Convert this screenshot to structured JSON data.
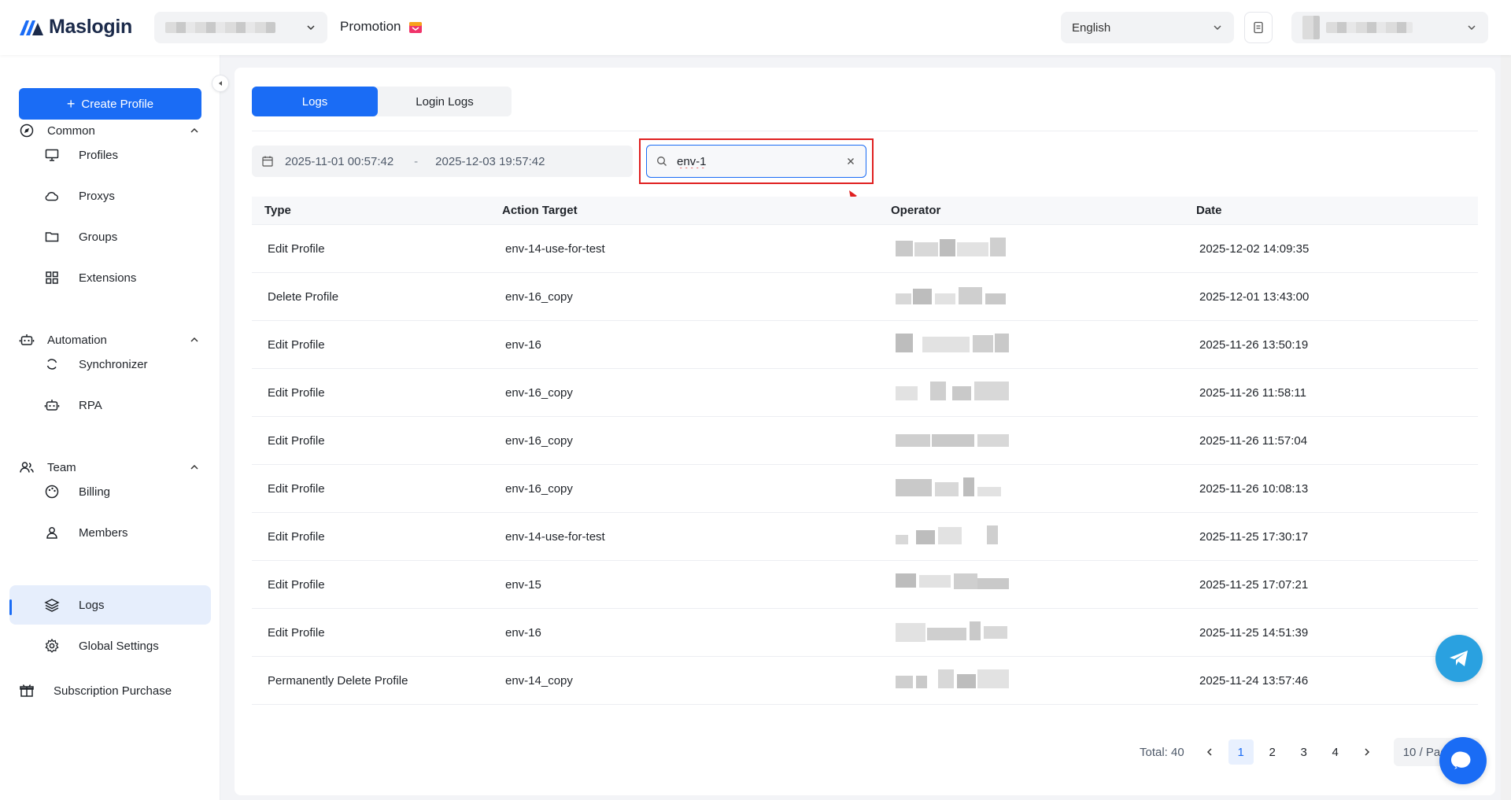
{
  "header": {
    "logo_text": "Maslogin",
    "promotion_label": "Promotion",
    "language": "English"
  },
  "sidebar": {
    "create_label": "Create Profile",
    "sections": {
      "common": "Common",
      "automation": "Automation",
      "team": "Team"
    },
    "items": {
      "profiles": "Profiles",
      "proxys": "Proxys",
      "groups": "Groups",
      "extensions": "Extensions",
      "synchronizer": "Synchronizer",
      "rpa": "RPA",
      "billing": "Billing",
      "members": "Members",
      "logs": "Logs",
      "global_settings": "Global Settings"
    },
    "subscription": "Subscription Purchase"
  },
  "tabs": {
    "logs": "Logs",
    "login_logs": "Login Logs"
  },
  "filters": {
    "start_date": "2025-11-01 00:57:42",
    "end_date": "2025-12-03 19:57:42",
    "range_sep": "-",
    "search_value": "env-1"
  },
  "table": {
    "headers": {
      "type": "Type",
      "target": "Action Target",
      "operator": "Operator",
      "date": "Date"
    },
    "rows": [
      {
        "type": "Edit Profile",
        "target": "env-14-use-for-test",
        "date": "2025-12-02 14:09:35"
      },
      {
        "type": "Delete Profile",
        "target": "env-16_copy",
        "date": "2025-12-01 13:43:00"
      },
      {
        "type": "Edit Profile",
        "target": "env-16",
        "date": "2025-11-26 13:50:19"
      },
      {
        "type": "Edit Profile",
        "target": "env-16_copy",
        "date": "2025-11-26 11:58:11"
      },
      {
        "type": "Edit Profile",
        "target": "env-16_copy",
        "date": "2025-11-26 11:57:04"
      },
      {
        "type": "Edit Profile",
        "target": "env-16_copy",
        "date": "2025-11-26 10:08:13"
      },
      {
        "type": "Edit Profile",
        "target": "env-14-use-for-test",
        "date": "2025-11-25 17:30:17"
      },
      {
        "type": "Edit Profile",
        "target": "env-15",
        "date": "2025-11-25 17:07:21"
      },
      {
        "type": "Edit Profile",
        "target": "env-16",
        "date": "2025-11-25 14:51:39"
      },
      {
        "type": "Permanently Delete Profile",
        "target": "env-14_copy",
        "date": "2025-11-24 13:57:46"
      }
    ]
  },
  "pagination": {
    "total": "Total: 40",
    "pages": [
      "1",
      "2",
      "3",
      "4"
    ],
    "current": "1",
    "page_size": "10 / Page"
  },
  "colors": {
    "primary": "#1a6cf5",
    "highlight": "#e02020",
    "telegram": "#2aa1e0"
  }
}
